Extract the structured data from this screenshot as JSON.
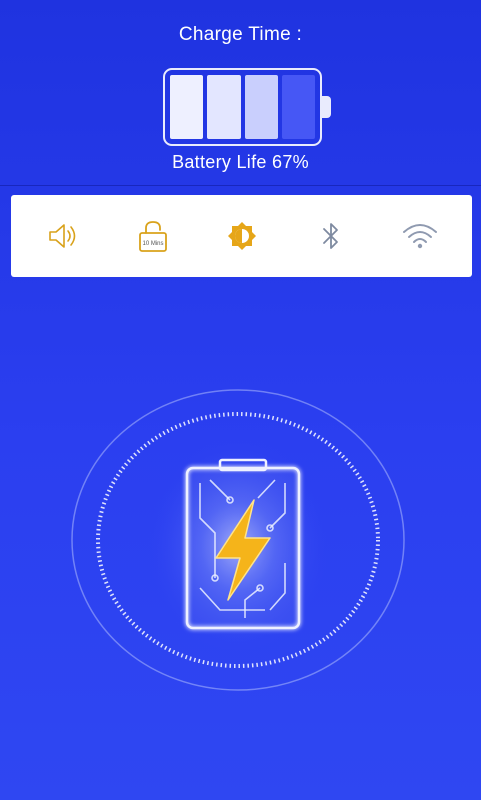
{
  "header": {
    "charge_time_label": "Charge Time :",
    "battery_life_text": "Battery Life 67%",
    "battery_level_percent": 67
  },
  "toggles": [
    {
      "name": "sound-toggle",
      "icon": "speaker-icon"
    },
    {
      "name": "screen-timeout-toggle",
      "icon": "lock-icon",
      "label": "10 Mins"
    },
    {
      "name": "brightness-toggle",
      "icon": "brightness-icon"
    },
    {
      "name": "bluetooth-toggle",
      "icon": "bluetooth-icon"
    },
    {
      "name": "wifi-toggle",
      "icon": "wifi-icon"
    }
  ],
  "colors": {
    "accent_gold": "#d9a21b",
    "inactive_gray": "#7e8aa0",
    "background_blue": "#2436e6",
    "bolt_yellow": "#f5b41a"
  }
}
